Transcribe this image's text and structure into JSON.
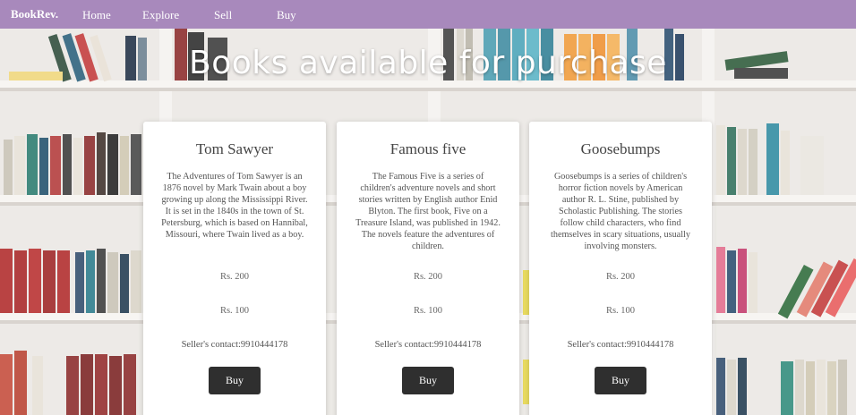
{
  "nav": {
    "brand": "BookRev.",
    "links": [
      "Home",
      "Explore",
      "Sell",
      "Buy"
    ]
  },
  "headline": "Books available for purchase",
  "cards": [
    {
      "title": "Tom Sawyer",
      "description": "The Adventures of Tom Sawyer is an 1876 novel by Mark Twain about a boy growing up along the Mississippi River. It is set in the 1840s in the town of St. Petersburg, which is based on Hannibal, Missouri, where Twain lived as a boy.",
      "price1": "Rs. 200",
      "price2": "Rs. 100",
      "contact": "Seller's contact:9910444178",
      "button": "Buy"
    },
    {
      "title": "Famous five",
      "description": "The Famous Five is a series of children's adventure novels and short stories written by English author Enid Blyton. The first book, Five on a Treasure Island, was published in 1942. The novels feature the adventures of children.",
      "price1": "Rs. 200",
      "price2": "Rs. 100",
      "contact": "Seller's contact:9910444178",
      "button": "Buy"
    },
    {
      "title": "Goosebumps",
      "description": "Goosebumps is a series of children's horror fiction novels by American author R. L. Stine, published by Scholastic Publishing. The stories follow child characters, who find themselves in scary situations, usually involving monsters.",
      "price1": "Rs. 200",
      "price2": "Rs. 100",
      "contact": "Seller's contact:9910444178",
      "button": "Buy"
    }
  ],
  "colors": {
    "navbar": "#a889bc",
    "button": "#2f2f2f",
    "shelf": "#f2f0ed"
  }
}
